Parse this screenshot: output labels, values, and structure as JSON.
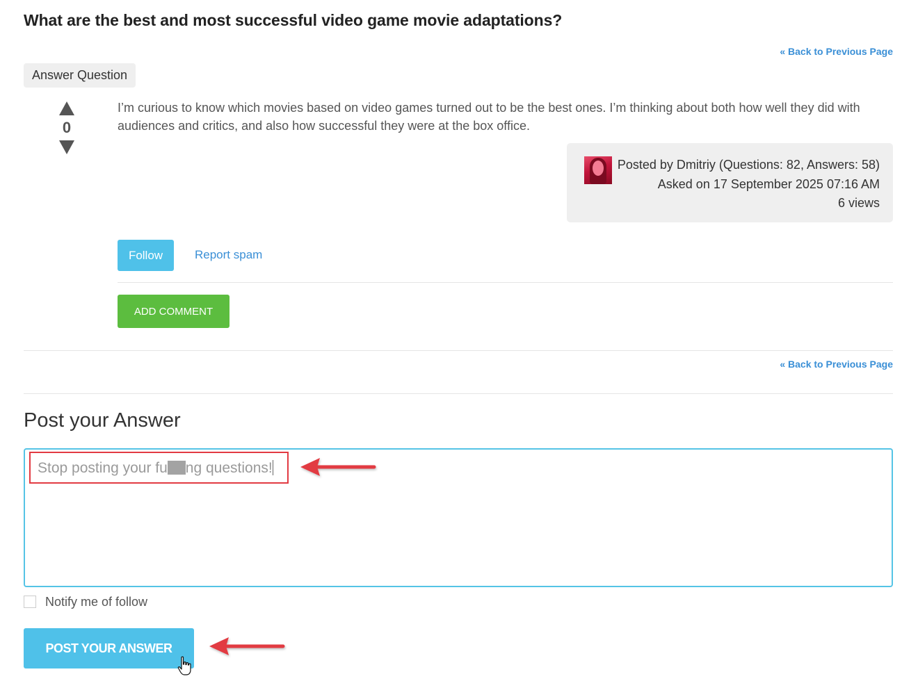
{
  "question": {
    "title": "What are the best and most successful video game movie adaptations?",
    "body": "I’m curious to know which movies based on video games turned out to be the best ones. I’m thinking about both how well they did with audiences and critics, and also how successful they were at the box office.",
    "votes": "0"
  },
  "nav": {
    "back_top": "« Back to Previous Page",
    "back_bottom": "« Back to Previous Page"
  },
  "answer_tag": "Answer Question",
  "meta": {
    "posted_by": "Posted by Dmitriy (Questions: 82, Answers: 58)",
    "asked_on": "Asked on 17 September 2025 07:16 AM",
    "views": "6 views"
  },
  "actions": {
    "follow": "Follow",
    "report_spam": "Report spam",
    "add_comment": "ADD COMMENT"
  },
  "answer_form": {
    "heading": "Post your Answer",
    "text_before": "Stop posting your fu",
    "text_after": "ng questions!",
    "notify_label": "Notify me of follow",
    "notify_checked": false,
    "submit": "POST YOUR ANSWER"
  },
  "colors": {
    "accent_blue": "#4fc1e9",
    "link_blue": "#3a8fd6",
    "comment_green": "#5cbd3f",
    "annotation_red": "#e23a42"
  },
  "icons": {
    "vote_up": "triangle-up-icon",
    "vote_down": "triangle-down-icon",
    "cursor": "hand-pointer-icon"
  }
}
